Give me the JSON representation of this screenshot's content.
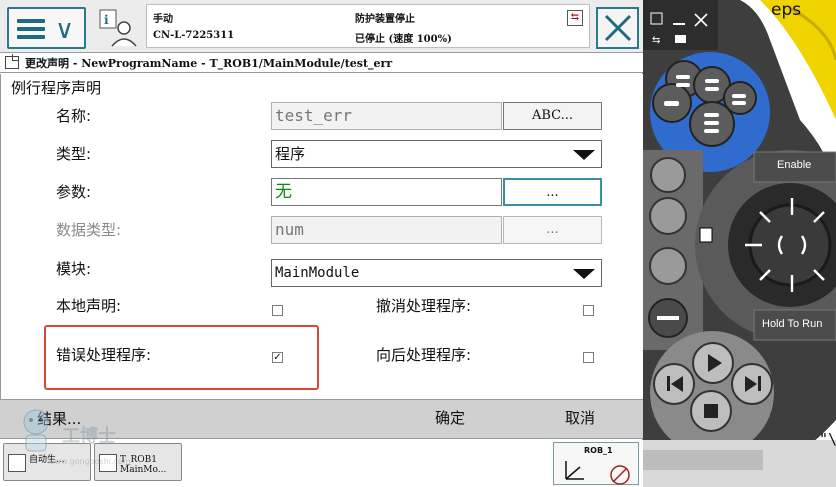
{
  "header": {
    "mode": "手动",
    "controller": "CN-L-7225311",
    "guard_status": "防护装置停止",
    "run_status": "已停止 (速度 100%)"
  },
  "breadcrumb": "更改声明 - NewProgramName - T_ROB1/MainModule/test_err",
  "form": {
    "title": "例行程序声明",
    "name_label": "名称:",
    "name_value": "test_err",
    "name_button": "ABC...",
    "type_label": "类型:",
    "type_value": "程序",
    "params_label": "参数:",
    "params_value": "无",
    "params_button": "...",
    "datatype_label": "数据类型:",
    "datatype_value": "num",
    "datatype_button": "...",
    "module_label": "模块:",
    "module_value": "MainModule",
    "local_label": "本地声明:",
    "local_checked": false,
    "undo_label": "撤消处理程序:",
    "undo_checked": false,
    "error_label": "错误处理程序:",
    "error_checked": true,
    "backward_label": "向后处理程序:",
    "backward_checked": false
  },
  "bottombar": {
    "result": "结果...",
    "ok": "确定",
    "cancel": "取消"
  },
  "taskbar": {
    "auto_task": "自动生...",
    "prog_line1": "T_ROB1",
    "prog_line2": "MainMo...",
    "quickset_label": "ROB_1"
  },
  "watermark": {
    "text": "工博士",
    "sub": "www.gongboshi.com"
  },
  "pendant": {
    "enable": "Enable",
    "hold_to_run": "Hold To Run",
    "top_text": "eps",
    "side_text": "\"\\"
  },
  "colors": {
    "accent": "#2a7a8c",
    "highlight": "#d74a3a",
    "pendant_gray": "#4a4a4a",
    "pendant_blue": "#2f6fd6",
    "yellow": "#f0d400"
  }
}
